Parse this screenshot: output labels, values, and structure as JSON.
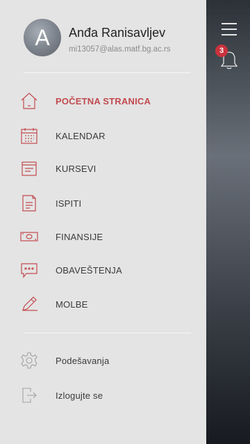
{
  "user": {
    "initial": "A",
    "name": "Anđa Ranisavljev",
    "email": "mi13057@alas.matf.bg.ac.rs"
  },
  "menu": {
    "items": [
      {
        "label": "POČETNA STRANICA",
        "icon": "home-icon",
        "active": true
      },
      {
        "label": "KALENDAR",
        "icon": "calendar-icon"
      },
      {
        "label": "KURSEVI",
        "icon": "courses-icon"
      },
      {
        "label": "ISPITI",
        "icon": "exams-icon"
      },
      {
        "label": "FINANSIJE",
        "icon": "money-icon"
      },
      {
        "label": "OBAVEŠTENJA",
        "icon": "notifications-icon"
      },
      {
        "label": "MOLBE",
        "icon": "pen-icon"
      }
    ],
    "secondary": [
      {
        "label": "Podešavanja",
        "icon": "gear-icon"
      },
      {
        "label": "Izlogujte se",
        "icon": "logout-icon"
      }
    ]
  },
  "notifications": {
    "count": "3"
  },
  "colors": {
    "accent": "#c24a4f",
    "drawer_bg": "#e4e4e4",
    "badge": "#c9333d"
  }
}
